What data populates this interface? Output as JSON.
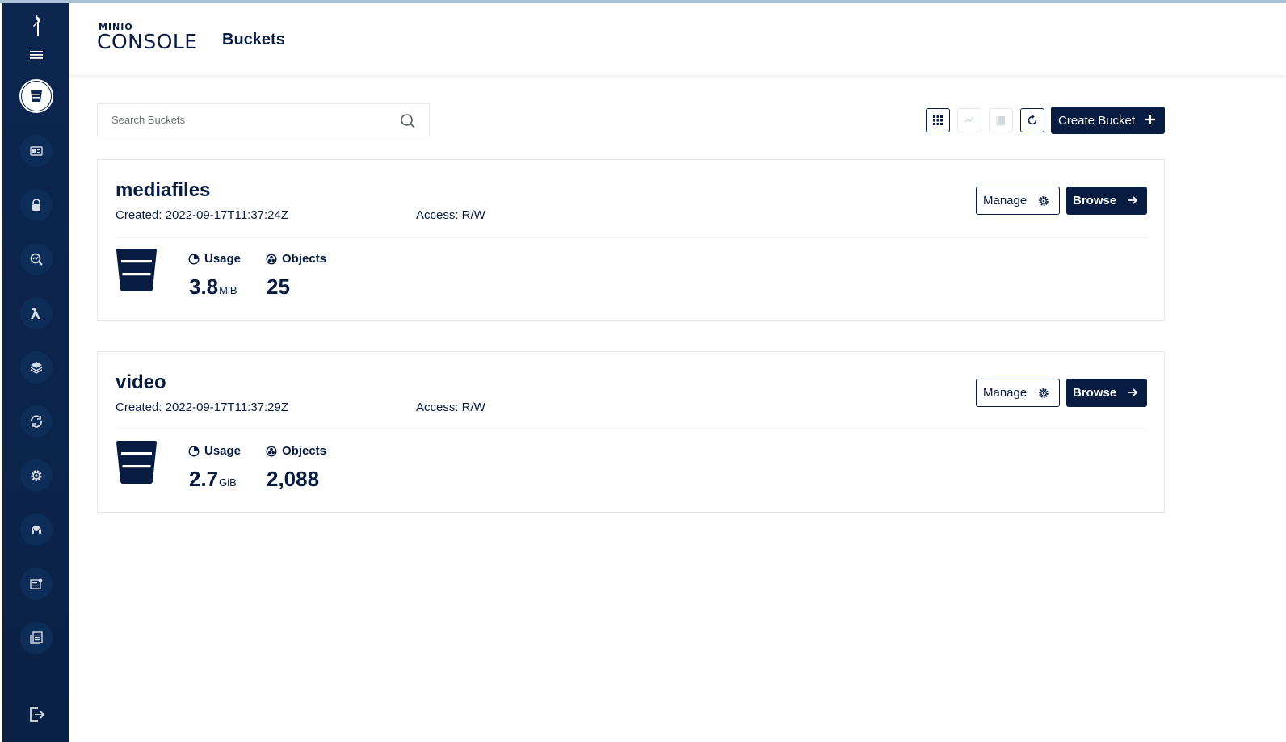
{
  "header": {
    "brand_small": "MINIO",
    "brand_big": "CONSOLE",
    "title": "Buckets"
  },
  "search": {
    "placeholder": "Search Buckets",
    "value": ""
  },
  "toolbar": {
    "create_label": "Create Bucket"
  },
  "buckets": [
    {
      "name": "mediafiles",
      "created": "Created: 2022-09-17T11:37:24Z",
      "access": "Access: R/W",
      "manage_label": "Manage",
      "browse_label": "Browse",
      "usage_label": "Usage",
      "usage_value": "3.8",
      "usage_unit": "MiB",
      "objects_label": "Objects",
      "objects_value": "25"
    },
    {
      "name": "video",
      "created": "Created: 2022-09-17T11:37:29Z",
      "access": "Access: R/W",
      "manage_label": "Manage",
      "browse_label": "Browse",
      "usage_label": "Usage",
      "usage_value": "2.7",
      "usage_unit": "GiB",
      "objects_label": "Objects",
      "objects_value": "2,088"
    }
  ],
  "sidebar": {
    "items": [
      {
        "icon": "bucket-icon",
        "active": true
      },
      {
        "icon": "identity-card-icon",
        "active": false
      },
      {
        "icon": "lock-icon",
        "active": false
      },
      {
        "icon": "monitoring-icon",
        "active": false
      },
      {
        "icon": "lambda-icon",
        "active": false
      },
      {
        "icon": "tiers-icon",
        "active": false
      },
      {
        "icon": "replication-icon",
        "active": false
      },
      {
        "icon": "settings-icon",
        "active": false
      },
      {
        "icon": "support-icon",
        "active": false
      },
      {
        "icon": "license-icon",
        "active": false
      },
      {
        "icon": "documentation-icon",
        "active": false
      }
    ]
  },
  "colors": {
    "navy": "#081c42",
    "sidebar": "#0c2650",
    "border": "#e4e7eb"
  }
}
